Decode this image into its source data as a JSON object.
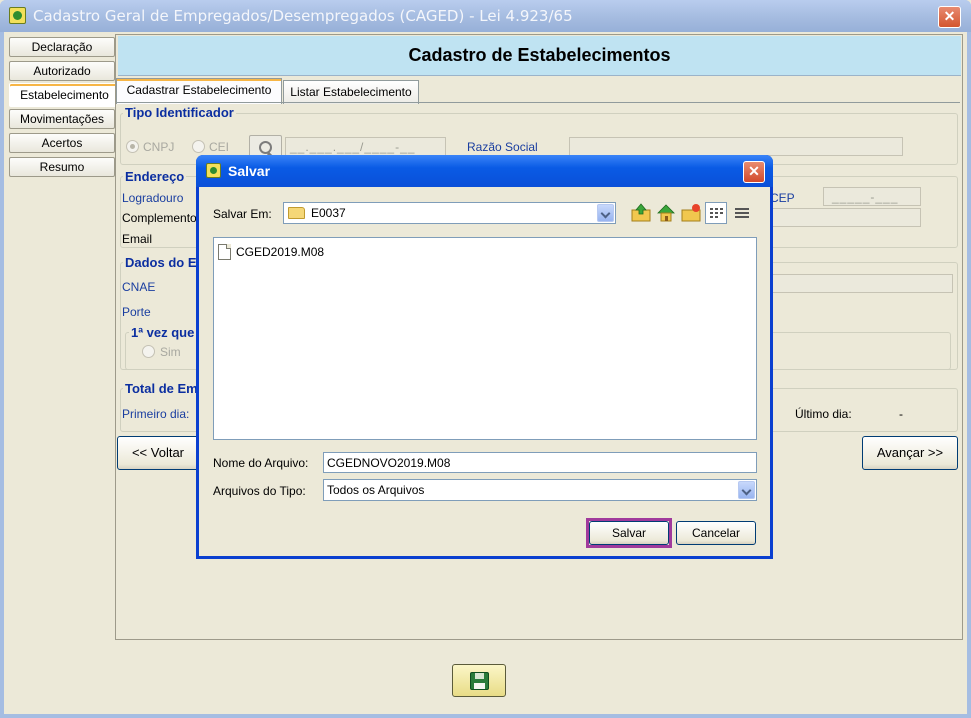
{
  "window": {
    "title": "Cadastro Geral de Empregados/Desempregados (CAGED) - Lei 4.923/65",
    "close": "✕"
  },
  "sidebar": {
    "items": [
      {
        "label": "Declaração"
      },
      {
        "label": "Autorizado"
      },
      {
        "label": "Estabelecimento",
        "active": true
      },
      {
        "label": "Movimentações"
      },
      {
        "label": "Acertos"
      },
      {
        "label": "Resumo"
      }
    ]
  },
  "page": {
    "title": "Cadastro de Estabelecimentos"
  },
  "tabs": [
    {
      "label": "Cadastrar Estabelecimento",
      "active": true
    },
    {
      "label": "Listar Estabelecimento"
    }
  ],
  "form": {
    "tipo_identificador": {
      "title": "Tipo Identificador",
      "cnpj": "CNPJ",
      "cei": "CEI",
      "mask": "__.___.___/____-__",
      "razao_social": "Razão Social"
    },
    "endereco": {
      "title": "Endereço",
      "logradouro": "Logradouro",
      "complemento": "Complemento",
      "email": "Email",
      "cep": "CEP",
      "cep_mask": "_____-___"
    },
    "dados": {
      "title": "Dados do E",
      "cnae": "CNAE",
      "porte": "Porte",
      "primeira_vez": "1ª vez que",
      "sim": "Sim"
    },
    "total": {
      "title": "Total de Em",
      "primeiro_dia": "Primeiro dia:",
      "ultimo_dia": "Último dia:",
      "ultimo_dia_value": "-"
    }
  },
  "nav": {
    "voltar": "<< Voltar",
    "avancar": "Avançar >>"
  },
  "dialog": {
    "title": "Salvar",
    "close": "✕",
    "salvar_em_label": "Salvar Em:",
    "salvar_em_value": "E0037",
    "files": [
      {
        "name": "CGED2019.M08"
      }
    ],
    "nome_label": "Nome do Arquivo:",
    "nome_value": "CGEDNOVO2019.M08",
    "tipo_label": "Arquivos do Tipo:",
    "tipo_value": "Todos os Arquivos",
    "save_button": "Salvar",
    "cancel_button": "Cancelar"
  }
}
